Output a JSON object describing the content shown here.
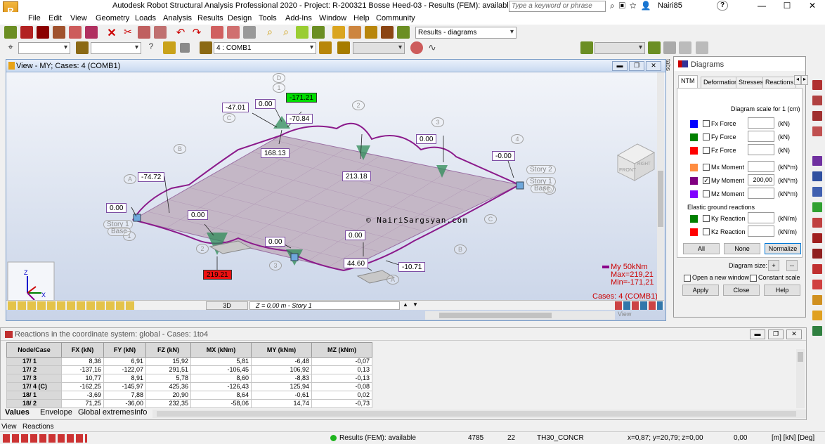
{
  "window": {
    "title": "Autodesk Robot Structural Analysis Professional 2020 - Project: R-200321 Bosse Heed-03 - Results (FEM): available",
    "search_placeholder": "Type a keyword or phrase",
    "user": "Nairi85",
    "help": "?",
    "logo_text": "R"
  },
  "menu": [
    "File",
    "Edit",
    "View",
    "Geometry",
    "Loads",
    "Analysis",
    "Results",
    "Design",
    "Tools",
    "Add-Ins",
    "Window",
    "Help",
    "Community"
  ],
  "toolbar": {
    "layout_select": "Results - diagrams",
    "case_select": "4 : COMB1"
  },
  "view": {
    "title": "View - MY; Cases: 4 (COMB1)",
    "cube_top": "TOP",
    "cube_front": "FRONT",
    "cube_right": "RIGHT",
    "mode": "3D",
    "level": "Z = 0,00 m - Story 1",
    "watermark": "© NairiSargsyan.com",
    "legend_name": "My  50kNm",
    "legend_max": "Max=219,21",
    "legend_min": "Min=-171,21",
    "cases": "Cases: 4 (COMB1)",
    "view_tab": "View",
    "tabs_label": "tabs",
    "axes": {
      "x": "X",
      "y": "Y",
      "z": "Z"
    },
    "gridlines": [
      "A",
      "B",
      "C",
      "D",
      "1",
      "2",
      "3",
      "4"
    ],
    "story_labels": [
      "Story 2",
      "Story 1",
      "Base",
      "Story 1",
      "Base"
    ],
    "labels": {
      "max_value": "219.21",
      "min_value": "-171.21",
      "v_n47": "-47.01",
      "v_000a": "0.00",
      "v_n7084": "-70.84",
      "v_16813": "168.13",
      "v_000b": "0.00",
      "v_21318": "213.18",
      "v_n000": "-0.00",
      "v_n7472": "-74.72",
      "v_000c": "0.00",
      "v_000d": "0.00",
      "v_000e": "0.00",
      "v_000f": "0.00",
      "v_4460": "44.60",
      "v_n1071": "-10.71"
    }
  },
  "diagrams": {
    "title": "Diagrams",
    "tabs": [
      "NTM",
      "Deformation",
      "Stresses",
      "Reactions"
    ],
    "scale_label": "Diagram scale for  1  (cm)",
    "rows": [
      {
        "label": "Fx Force",
        "unit": "(kN)",
        "color": "#0000ff",
        "checked": "",
        "value": ""
      },
      {
        "label": "Fy Force",
        "unit": "(kN)",
        "color": "#008000",
        "checked": "",
        "value": ""
      },
      {
        "label": "Fz Force",
        "unit": "(kN)",
        "color": "#ff0000",
        "checked": "",
        "value": ""
      },
      {
        "label": "Mx Moment",
        "unit": "(kN*m)",
        "color": "#ff8c40",
        "checked": "",
        "value": ""
      },
      {
        "label": "My Moment",
        "unit": "(kN*m)",
        "color": "#800080",
        "checked": "✓",
        "value": "200,00"
      },
      {
        "label": "Mz Moment",
        "unit": "(kN*m)",
        "color": "#8000ff",
        "checked": "",
        "value": ""
      }
    ],
    "elastic_label": "Elastic ground reactions",
    "elastic_rows": [
      {
        "label": "Ky Reaction",
        "unit": "(kN/m)",
        "color": "#008000",
        "checked": "",
        "value": ""
      },
      {
        "label": "Kz Reaction",
        "unit": "(kN/m)",
        "color": "#ff0000",
        "checked": "",
        "value": ""
      }
    ],
    "btn_all": "All",
    "btn_none": "None",
    "btn_normalize": "Normalize",
    "size_label": "Diagram size:",
    "size_plus": "+",
    "size_minus": "--",
    "open_new": "Open a new window",
    "constant_scale": "Constant scale",
    "btn_apply": "Apply",
    "btn_close": "Close",
    "btn_help": "Help"
  },
  "reactions": {
    "title": "Reactions in the coordinate system: global - Cases:  1to4",
    "columns": [
      "Node/Case",
      "FX (kN)",
      "FY (kN)",
      "FZ (kN)",
      "MX (kNm)",
      "MY (kNm)",
      "MZ (kNm)"
    ],
    "rows": [
      [
        "17/    1",
        "8,36",
        "6,91",
        "15,92",
        "5,81",
        "-6,48",
        "-0,07"
      ],
      [
        "17/    2",
        "-137,16",
        "-122,07",
        "291,51",
        "-106,45",
        "106,92",
        "0,13"
      ],
      [
        "17/    3",
        "10,77",
        "8,91",
        "5,78",
        "8,60",
        "-8,83",
        "-0,13"
      ],
      [
        "17/    4 (C)",
        "-162,25",
        "-145,97",
        "425,36",
        "-126,43",
        "125,94",
        "-0,08"
      ],
      [
        "18/    1",
        "-3,69",
        "7,88",
        "20,90",
        "8,64",
        "-0,61",
        "0,02"
      ],
      [
        "18/    2",
        "71,25",
        "-36,00",
        "232,35",
        "-58,06",
        "14,74",
        "-0,73"
      ]
    ],
    "tabs": [
      "Values",
      "Envelope",
      "Global extremes",
      "Info"
    ]
  },
  "bottom_tabs": [
    "View",
    "Reactions"
  ],
  "status": {
    "results": "Results (FEM): available",
    "n1": "4785",
    "n2": "22",
    "material": "TH30_CONCR",
    "coords": "x=0,87; y=20,79; z=0,00",
    "angle": "0,00",
    "units": "[m] [kN] [Deg]"
  }
}
